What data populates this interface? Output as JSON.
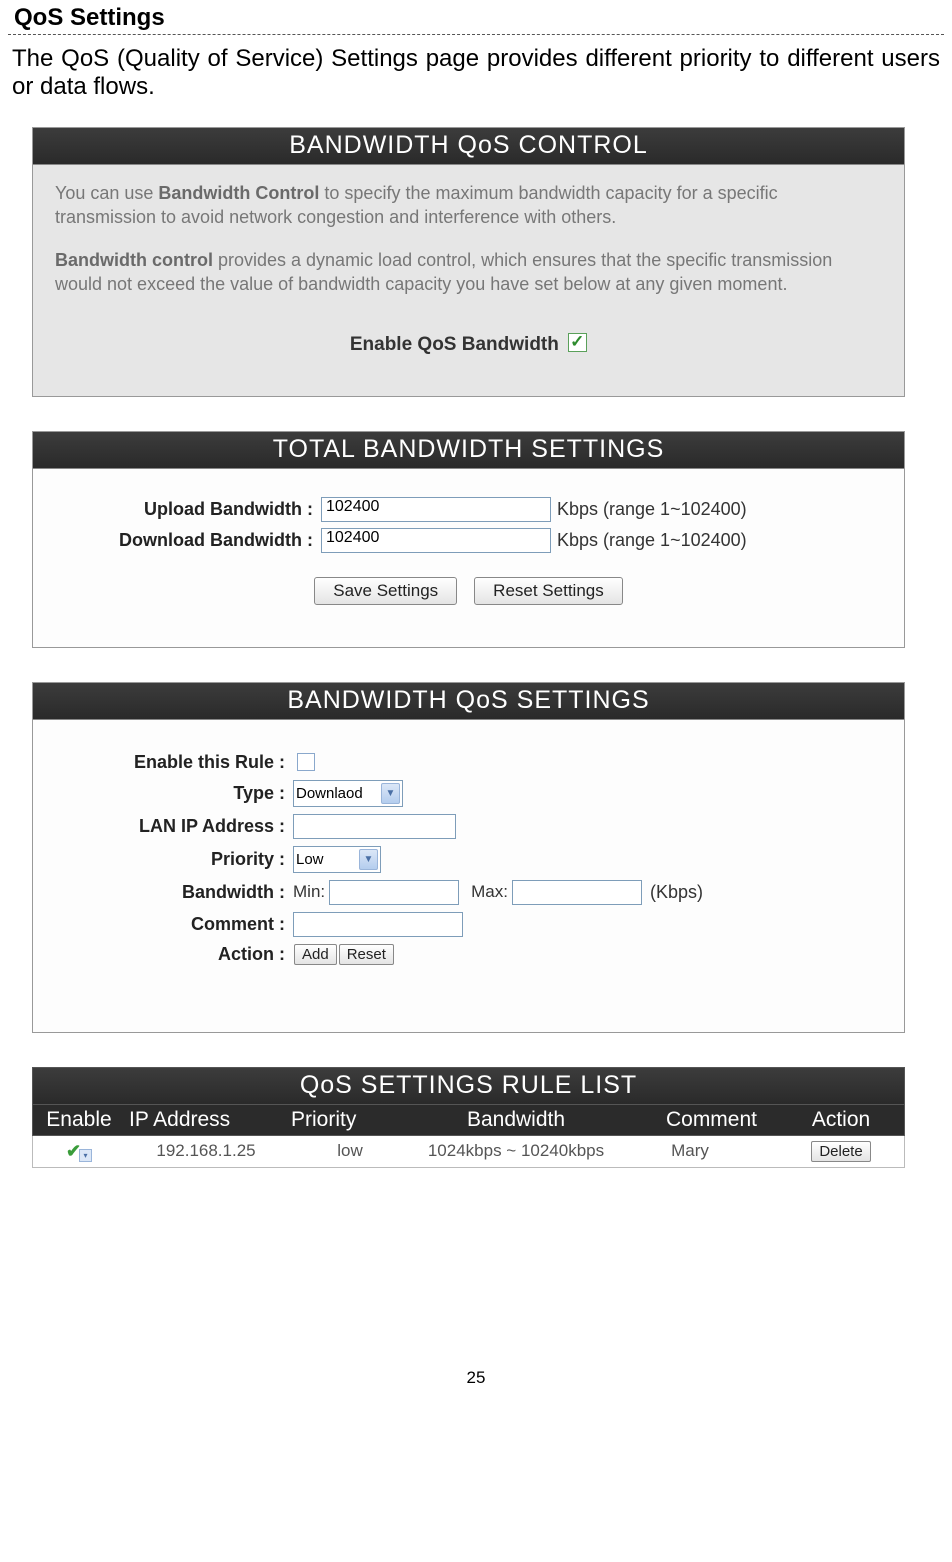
{
  "title": "QoS Settings",
  "intro": "The QoS (Quality of Service) Settings page provides different priority to different users or data flows.",
  "panel1": {
    "header": "BANDWIDTH QoS CONTROL",
    "para1_a": "You can use ",
    "para1_b": "Bandwidth Control",
    "para1_c": " to specify the maximum bandwidth capacity for a specific transmission to avoid network congestion and interference with others.",
    "para2_a": "Bandwidth control",
    "para2_b": " provides a dynamic load control, which ensures that the specific transmission would not exceed the value of bandwidth capacity you have set below at any given moment.",
    "enable_label": "Enable QoS Bandwidth"
  },
  "panel2": {
    "header": "TOTAL BANDWIDTH SETTINGS",
    "upload_label": "Upload Bandwidth :",
    "upload_value": "102400",
    "download_label": "Download Bandwidth :",
    "download_value": "102400",
    "hint": "Kbps (range 1~102400)",
    "save_btn": "Save Settings",
    "reset_btn": "Reset Settings"
  },
  "panel3": {
    "header": "BANDWIDTH QoS SETTINGS",
    "enable_rule_label": "Enable this Rule :",
    "type_label": "Type :",
    "type_value": "Downlaod",
    "lanip_label": "LAN IP Address :",
    "priority_label": "Priority :",
    "priority_value": "Low",
    "bandwidth_label": "Bandwidth :",
    "min_label": "Min:",
    "max_label": "Max:",
    "kbps": "(Kbps)",
    "comment_label": "Comment :",
    "action_label": "Action :",
    "add_btn": "Add",
    "reset_btn": "Reset"
  },
  "rulelist": {
    "header": "QoS SETTINGS RULE LIST",
    "cols": {
      "enable": "Enable",
      "ip": "IP Address",
      "priority": "Priority",
      "bandwidth": "Bandwidth",
      "comment": "Comment",
      "action": "Action"
    },
    "row": {
      "ip": "192.168.1.25",
      "priority": "low",
      "bandwidth": "1024kbps ~ 10240kbps",
      "comment": "Mary",
      "delete": "Delete"
    }
  },
  "page_number": "25"
}
